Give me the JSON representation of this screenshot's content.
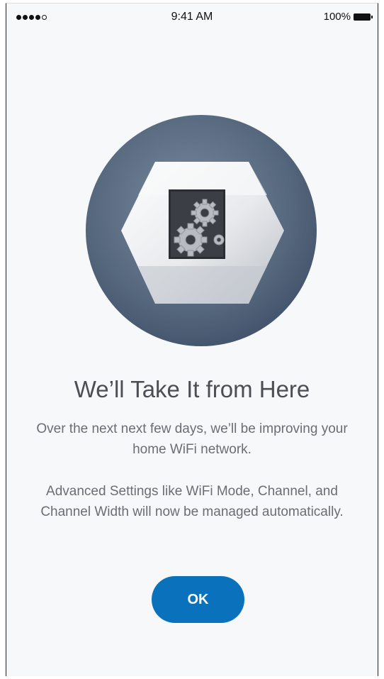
{
  "status_bar": {
    "time": "9:41 AM",
    "battery": "100%",
    "signal_bars_filled": 4,
    "signal_bars_total": 5
  },
  "illustration": {
    "icon": "router-with-gears-icon"
  },
  "content": {
    "title": "We’ll Take It from Here",
    "paragraph_1": "Over the next next few days, we’ll be improving your home WiFi network.",
    "paragraph_2": "Advanced Settings like WiFi Mode, Channel, and Channel Width will now be managed automatically."
  },
  "actions": {
    "ok_label": "OK"
  },
  "colors": {
    "accent": "#0a72bd",
    "background": "#f6f8fa",
    "title_text": "#4b4f54",
    "body_text": "#6a6e73",
    "circle": "#5e6f82"
  }
}
